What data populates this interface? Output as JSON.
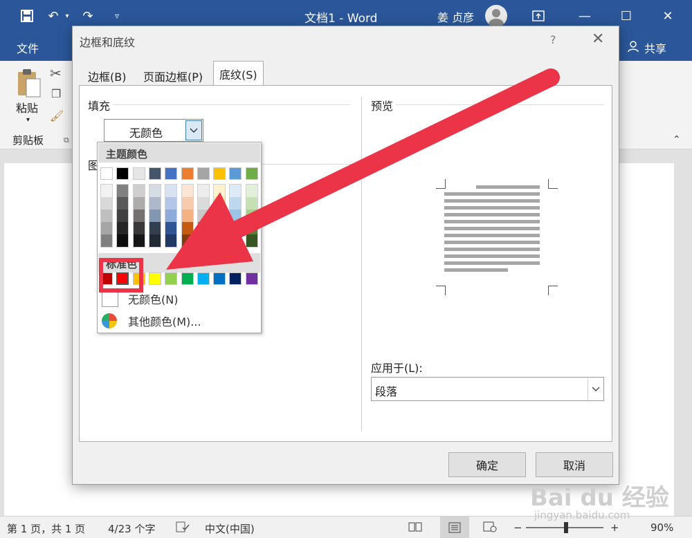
{
  "titlebar": {
    "document_title": "文档1 - Word",
    "user_name": "姜 贞彦",
    "qat": [
      "save-icon",
      "undo-icon",
      "redo-icon",
      "customize-icon"
    ]
  },
  "menubar": {
    "file_tab": "文件",
    "share_label": "共享"
  },
  "ribbon": {
    "paste_label": "粘贴",
    "clipboard_group": "剪贴板"
  },
  "dialog": {
    "title": "边框和底纹",
    "help_label": "?",
    "close_label": "✕",
    "tabs": [
      "边框(B)",
      "页面边框(P)",
      "底纹(S)"
    ],
    "fill": {
      "label": "填充",
      "value": "无颜色"
    },
    "pattern_label_partial": "图",
    "preview": {
      "label": "预览"
    },
    "apply_to": {
      "label": "应用于(L):",
      "value": "段落"
    },
    "ok_button": "确定",
    "cancel_button": "取消"
  },
  "color_palette": {
    "theme_header": "主题颜色",
    "standard_header": "标准色",
    "theme_colors": [
      "#ffffff",
      "#000000",
      "#e7e6e6",
      "#44546a",
      "#4472c4",
      "#ed7d31",
      "#a5a5a5",
      "#ffc000",
      "#5b9bd5",
      "#70ad47"
    ],
    "theme_shades": [
      [
        "#f2f2f2",
        "#d9d9d9",
        "#bfbfbf",
        "#a6a6a6",
        "#808080"
      ],
      [
        "#808080",
        "#595959",
        "#404040",
        "#262626",
        "#0d0d0d"
      ],
      [
        "#d0cece",
        "#aeabab",
        "#757171",
        "#3a3838",
        "#171616"
      ],
      [
        "#d6dce4",
        "#adb9ca",
        "#8497b0",
        "#333f4f",
        "#222a35"
      ],
      [
        "#d9e2f3",
        "#b4c6e7",
        "#8eaadb",
        "#2f5496",
        "#1f3864"
      ],
      [
        "#fbe5d5",
        "#f7cbac",
        "#f4b183",
        "#c55a11",
        "#843c0c"
      ],
      [
        "#ededed",
        "#dbdbdb",
        "#c9c9c9",
        "#7b7b7b",
        "#525252"
      ],
      [
        "#fff2cc",
        "#fee599",
        "#ffd965",
        "#bf9000",
        "#7f6000"
      ],
      [
        "#deebf6",
        "#bdd7ee",
        "#9dc3e6",
        "#2e75b5",
        "#1f4e79"
      ],
      [
        "#e2efd9",
        "#c5e0b3",
        "#a8d08d",
        "#538135",
        "#375623"
      ]
    ],
    "standard_colors": [
      "#c00000",
      "#ff0000",
      "#ffc000",
      "#ffff00",
      "#92d050",
      "#00b050",
      "#00b0f0",
      "#0070c0",
      "#002060",
      "#7030a0"
    ],
    "selected_standard": "#ff0000",
    "no_color_label": "无颜色(N)",
    "more_colors_label": "其他颜色(M)..."
  },
  "statusbar": {
    "page": "第 1 页，共 1 页",
    "words": "4/23 个字",
    "language": "中文(中国)",
    "zoom_minus": "−",
    "zoom_plus": "+",
    "zoom": "90%",
    "zoom_fraction": 0.52
  },
  "watermark": {
    "main": "Bai du 经验",
    "sub": "jingyan.baidu.com"
  },
  "colors": {
    "word_blue": "#2b579a",
    "annotation_red": "#ec3448"
  }
}
